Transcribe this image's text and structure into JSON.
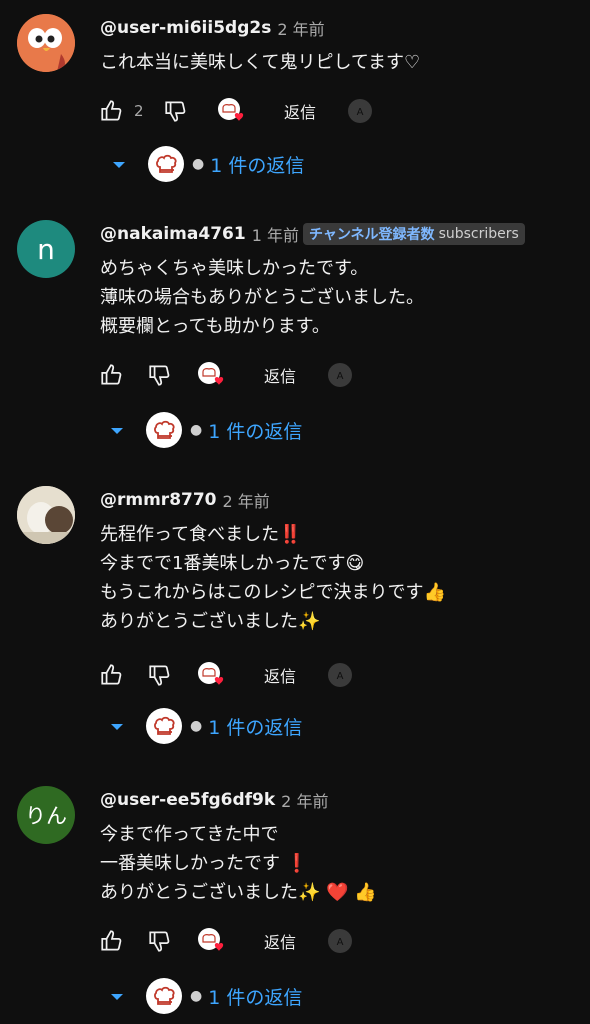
{
  "colors": {
    "background": "#0f0f0f",
    "link": "#3ea6ff",
    "text": "#f1f1f1",
    "muted": "#aaaaaa"
  },
  "comments": [
    {
      "author": "@user-mi6ii5dg2s",
      "time": "2 年前",
      "lines": [
        "これ本当に美味しくて鬼リピしてます♡"
      ],
      "like_count": "2",
      "reply_label": "返信",
      "replies_label": "1 件の返信",
      "avatar_icon": "orange-bird-avatar"
    },
    {
      "author": "@nakaima4761",
      "time": "1 年前",
      "badge_strong": "チャンネル登録者数",
      "badge_weak": "subscribers",
      "avatar_letter": "n",
      "lines": [
        "めちゃくちゃ美味しかったです。",
        "薄味の場合もありがとうございました。",
        "概要欄とっても助かります。"
      ],
      "like_count": "",
      "reply_label": "返信",
      "replies_label": "1 件の返信"
    },
    {
      "author": "@rmmr8770",
      "time": "2 年前",
      "lines": [
        "先程作って食べました‼️",
        "今までで1番美味しかったです😋",
        "もうこれからはこのレシピで決まりです👍",
        "ありがとうございました✨"
      ],
      "like_count": "",
      "reply_label": "返信",
      "replies_label": "1 件の返信",
      "avatar_icon": "photo-avatar"
    },
    {
      "author": "@user-ee5fg6df9k",
      "time": "2 年前",
      "avatar_letter": "りん",
      "lines": [
        "今まで作ってきた中で",
        "一番美味しかったです ❗",
        "ありがとうございました✨ ❤️ 👍"
      ],
      "like_count": "",
      "reply_label": "返信",
      "replies_label": "1 件の返信"
    }
  ]
}
